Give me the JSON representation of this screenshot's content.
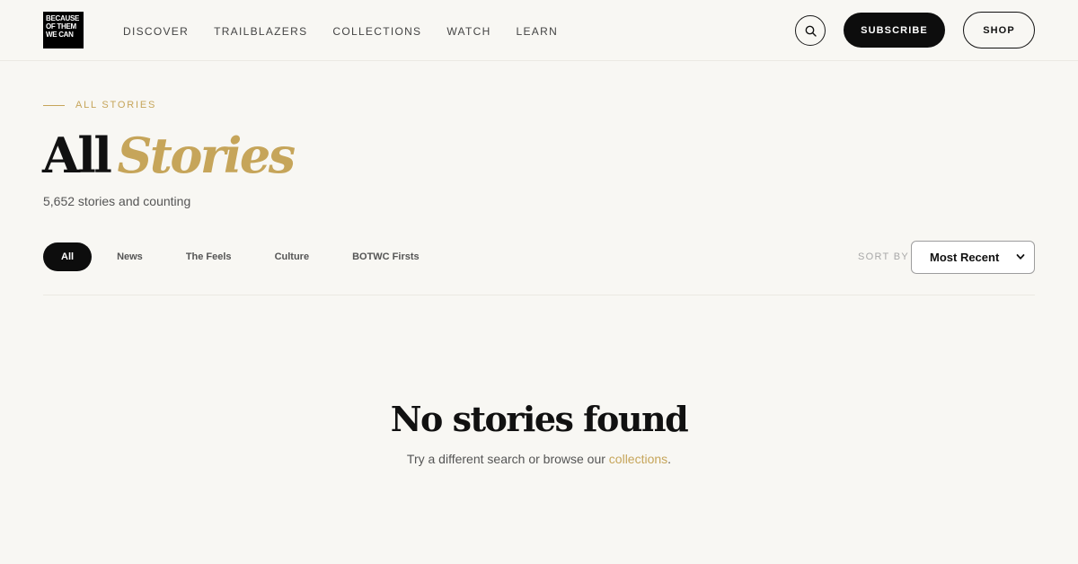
{
  "header": {
    "logo_lines": [
      "BECAUSE",
      "OF THEM",
      "WE CAN"
    ],
    "nav": [
      "DISCOVER",
      "TRAILBLAZERS",
      "COLLECTIONS",
      "WATCH",
      "LEARN"
    ],
    "search_icon": "search-icon",
    "subscribe_label": "SUBSCRIBE",
    "shop_label": "SHOP"
  },
  "hero": {
    "eyebrow": "ALL STORIES",
    "title_plain": "All",
    "title_accent": "Stories",
    "count_text": "5,652 stories and counting"
  },
  "filters": {
    "chips": [
      "All",
      "News",
      "The Feels",
      "Culture",
      "BOTWC Firsts"
    ],
    "active": "All",
    "sort_label": "SORT BY",
    "sort_value": "Most Recent"
  },
  "empty": {
    "title": "No stories found",
    "text_before": "Try a different search or browse our ",
    "link": "collections",
    "text_after": "."
  },
  "colors": {
    "background": "#f8f7f3",
    "accent": "#c6a55a",
    "dark": "#0d0d0d"
  }
}
